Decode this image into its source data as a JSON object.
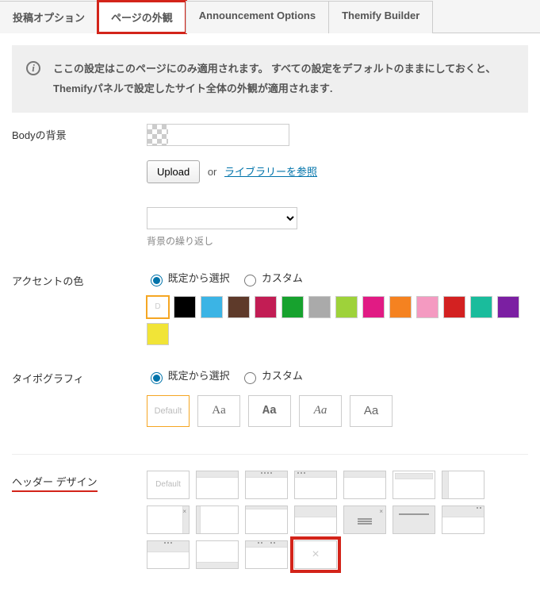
{
  "tabs": {
    "post_options": "投稿オプション",
    "page_appearance": "ページの外観",
    "announcement": "Announcement Options",
    "themify": "Themify Builder"
  },
  "info_text": "ここの設定はこのページにのみ適用されます。 すべての設定をデフォルトのままにしておくと、Themifyパネルで設定したサイト全体の外観が適用されます.",
  "body_bg": {
    "label": "Bodyの背景",
    "upload_btn": "Upload",
    "or_text": "or",
    "library_link": "ライブラリーを参照",
    "repeat_hint": "背景の繰り返し"
  },
  "accent": {
    "label": "アクセントの色",
    "radio_preset": "既定から選択",
    "radio_custom": "カスタム",
    "default_swatch_text": "D",
    "colors": [
      "#000000",
      "#3bb4e5",
      "#5e3a2a",
      "#c21d54",
      "#17a22e",
      "#aaaaaa",
      "#9ed23a",
      "#e11b84",
      "#f58220",
      "#f49ac1",
      "#d32121",
      "#1abc9c",
      "#7b1fa2",
      "#f1e437"
    ]
  },
  "typography": {
    "label": "タイポグラフィ",
    "radio_preset": "既定から選択",
    "radio_custom": "カスタム",
    "default_text": "Default",
    "sample": "Aa"
  },
  "header_design": {
    "label": "ヘッダー デザイン",
    "default_text": "Default"
  }
}
